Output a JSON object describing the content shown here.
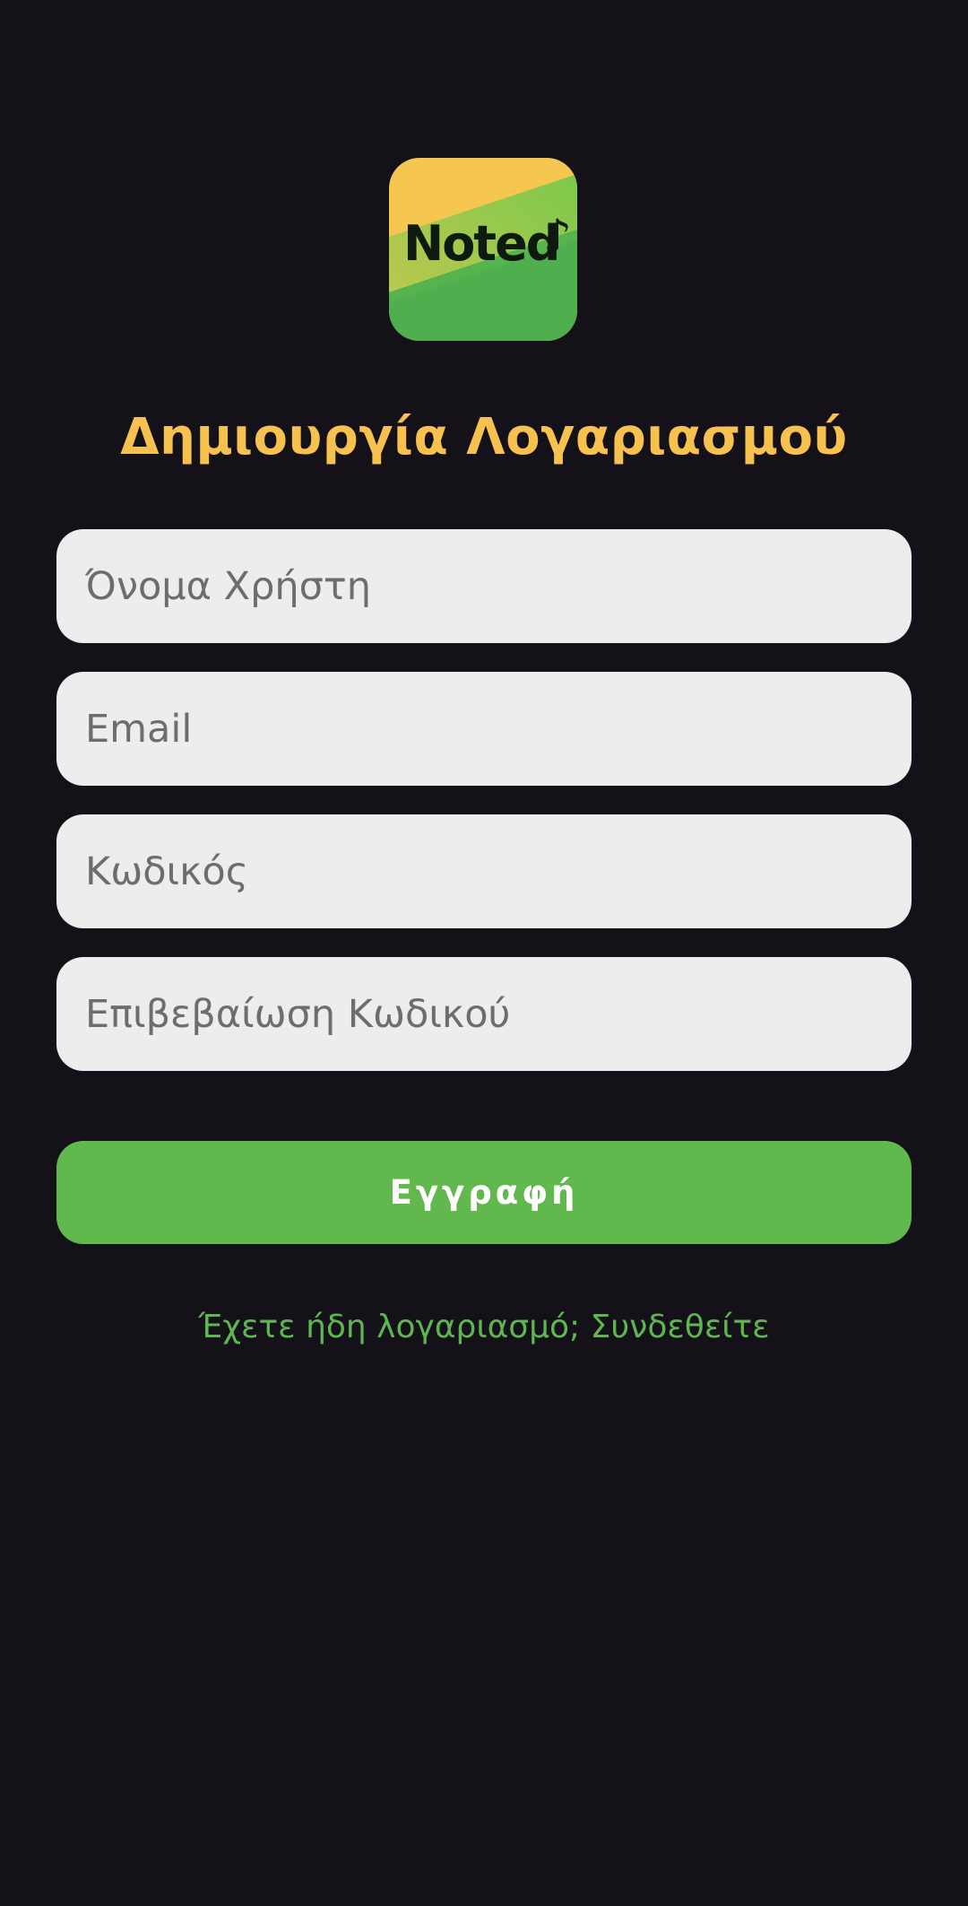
{
  "logo": {
    "text": "Noted",
    "glyph": "♪",
    "colors": {
      "yellow": "#f6c750",
      "green_light": "#8fcf4f",
      "green_dark": "#4fae4d",
      "text": "#0e1a0e"
    }
  },
  "title": "Δημιουργία Λογαριασμού",
  "form": {
    "username_placeholder": "Όνομα Χρήστη",
    "email_placeholder": "Email",
    "password_placeholder": "Κωδικός",
    "confirm_password_placeholder": "Επιβεβαίωση Κωδικού",
    "submit_label": "Εγγραφή"
  },
  "login_link": "Έχετε ήδη λογαριασμό; Συνδεθείτε",
  "colors": {
    "background": "#141118",
    "title": "#f6c14f",
    "field_background": "#ededed",
    "field_placeholder": "#6d6d6d",
    "button": "#61b84d",
    "link": "#5eb650"
  }
}
